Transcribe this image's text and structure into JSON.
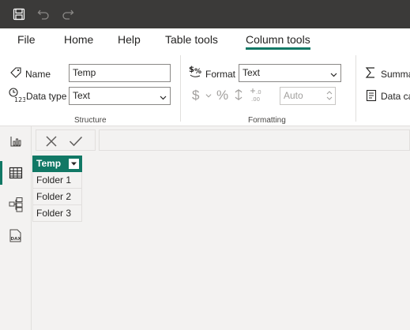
{
  "titlebar": {
    "icons": [
      "save-icon",
      "undo-icon",
      "redo-icon"
    ]
  },
  "tabs": [
    {
      "label": "File"
    },
    {
      "label": "Home"
    },
    {
      "label": "Help"
    },
    {
      "label": "Table tools"
    },
    {
      "label": "Column tools",
      "active": true
    }
  ],
  "structure": {
    "name_label": "Name",
    "name_value": "Temp",
    "datatype_label": "Data type",
    "datatype_value": "Text",
    "group_label": "Structure"
  },
  "formatting": {
    "format_label": "Format",
    "format_value": "Text",
    "currency_symbol": "$",
    "percent_symbol": "%",
    "decimals_value": "Auto",
    "group_label": "Formatting"
  },
  "properties": {
    "summarize_label": "Summa",
    "datacategory_label": "Data ca"
  },
  "leftnav": {
    "items": [
      "report-view-icon",
      "table-view-icon",
      "model-view-icon",
      "dax-query-view-icon"
    ],
    "active": "table-view-icon"
  },
  "table": {
    "column_header": "Temp",
    "rows": [
      "Folder 1",
      "Folder 2",
      "Folder 3"
    ]
  },
  "colors": {
    "accent": "#117865",
    "titlebar": "#3b3a39"
  }
}
